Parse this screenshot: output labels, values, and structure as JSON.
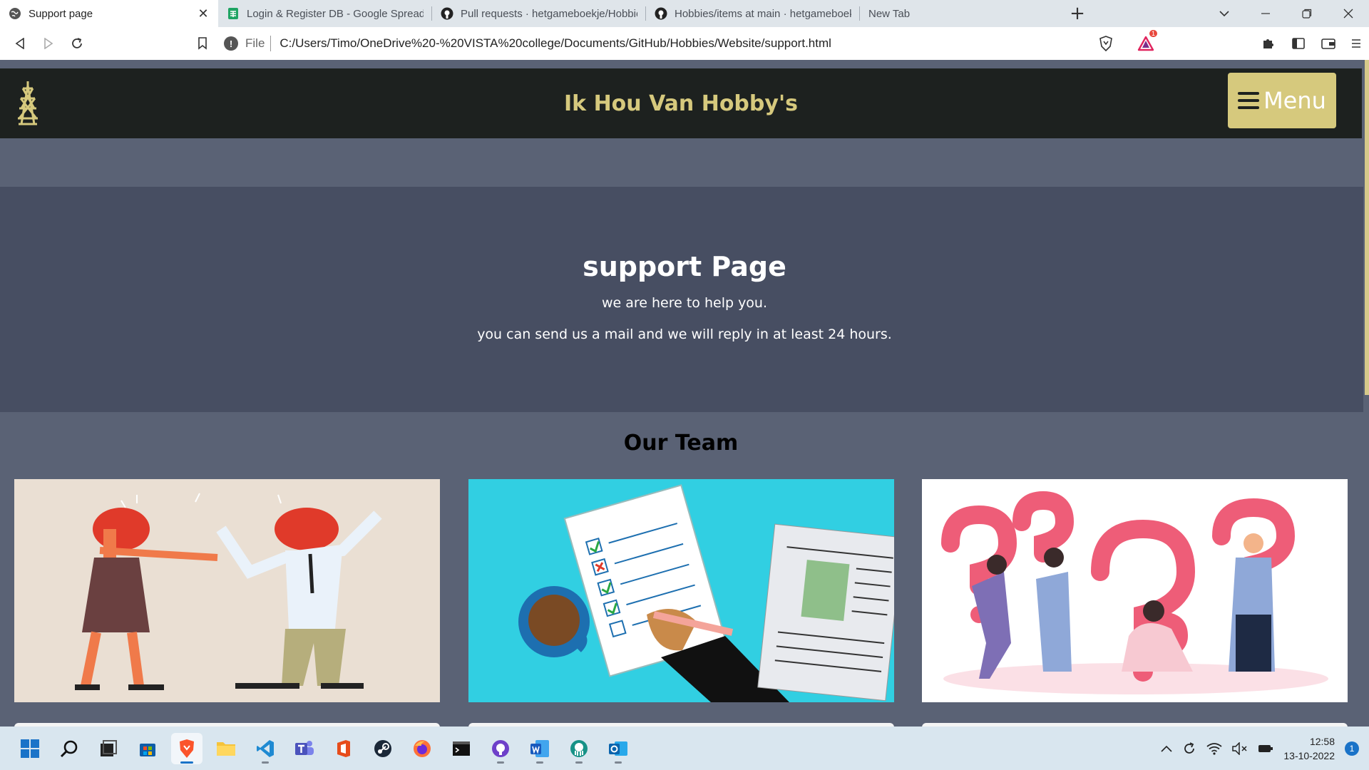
{
  "browser": {
    "tabs": [
      {
        "title": "Support page",
        "icon": "globe-icon",
        "active": true
      },
      {
        "title": "Login & Register DB - Google Spreads",
        "icon": "sheets-icon"
      },
      {
        "title": "Pull requests · hetgameboekje/Hobbie",
        "icon": "github-icon"
      },
      {
        "title": "Hobbies/items at main · hetgameboek",
        "icon": "github-icon"
      },
      {
        "title": "New Tab",
        "icon": ""
      }
    ],
    "close_glyph": "✕",
    "new_tab_glyph": "+",
    "address": {
      "scheme_label": "File",
      "url": "C:/Users/Timo/OneDrive%20-%20VISTA%20college/Documents/GitHub/Hobbies/Website/support.html"
    },
    "brave_badge_count": "1"
  },
  "site": {
    "title": "Ik Hou Van Hobby's",
    "menu_label": "Menu",
    "hero": {
      "heading": "support Page",
      "line1": "we are here to help you.",
      "line2": "you can send us a mail and we will reply in at least 24 hours."
    },
    "team_heading": "Our Team",
    "cards": [
      {
        "image": "arguing-people-illustration"
      },
      {
        "image": "checklist-newspaper-illustration"
      },
      {
        "image": "question-marks-people-illustration"
      }
    ],
    "colors": {
      "nav_bg": "#1d211f",
      "accent": "#d6c97d",
      "hero_bg": "#474e62",
      "page_bg": "#5a6275"
    }
  },
  "taskbar": {
    "time": "12:58",
    "date": "13-10-2022",
    "notification_count": "1"
  }
}
